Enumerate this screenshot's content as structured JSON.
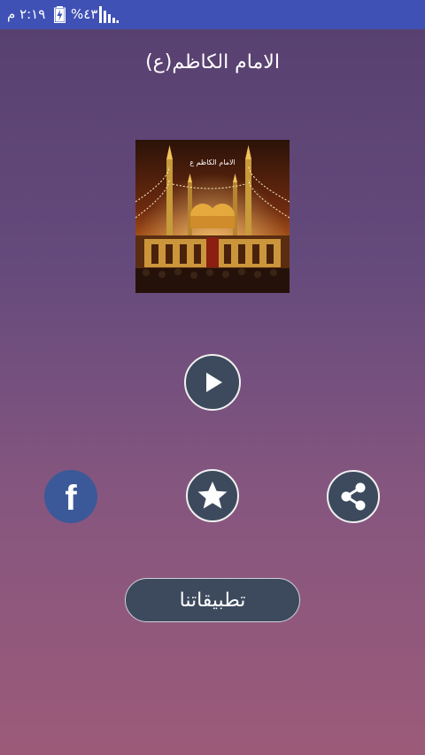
{
  "status_bar": {
    "time": "٢:١٩ م",
    "battery_percent": "%٤٣",
    "battery_icon": "battery-charging-icon",
    "signal_icon": "signal-icon",
    "color": "#3f51b5"
  },
  "title": "الامام الكاظم(ع)",
  "image": {
    "caption": "الامام الكاظم ع"
  },
  "buttons": {
    "play_icon": "play-icon",
    "facebook_label": "f",
    "rate_icon": "star-icon",
    "share_icon": "share-icon",
    "apps_label": "تطبيقاتنا"
  },
  "colors": {
    "button_bg": "#3d4a5d",
    "facebook": "#3b5998"
  }
}
